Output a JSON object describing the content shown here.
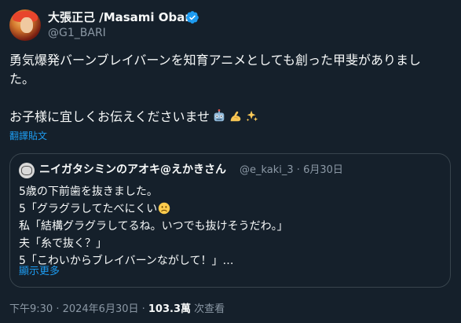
{
  "author": {
    "display_name": "大張正己 /Masami Obari",
    "handle": "@G1_BARI"
  },
  "tweet": {
    "line1": "勇気爆発バーンブレイバーンを知育アニメとしても創った甲斐がありまし",
    "line2": "た。",
    "line3": "お子様に宜しくお伝えくださいませ",
    "translate_label": "翻譯貼文"
  },
  "quote": {
    "display_name": "ニイガタシミンのアオキ@えかきさん",
    "meta": "@e_kaki_3 · 6月30日",
    "line1": "5歳の下前歯を抜きました。",
    "line2": "5「グラグラしてたべにくい",
    "line3": "私「結構グラグラしてるね。いつでも抜けそうだわ。」",
    "line4": "夫「糸で抜く？」",
    "line5": "5「こわいからブレイバーンながして！」…",
    "show_more": "顯示更多"
  },
  "footer": {
    "time": "下午9:30 · 2024年6月30日 · ",
    "views_count": "103.3萬",
    "views_label": " 次查看"
  },
  "colors": {
    "background": "#15202b",
    "text": "#f7f9f9",
    "secondary": "#8b98a5",
    "accent": "#1d9bf0",
    "border": "#38444d"
  },
  "icons": {
    "verified": "verified-badge-icon",
    "emoji_robot": "robot-face-emoji",
    "emoji_flex": "flexed-biceps-emoji",
    "emoji_sparkles": "sparkles-emoji",
    "emoji_sad": "slightly-frowning-face-emoji"
  }
}
